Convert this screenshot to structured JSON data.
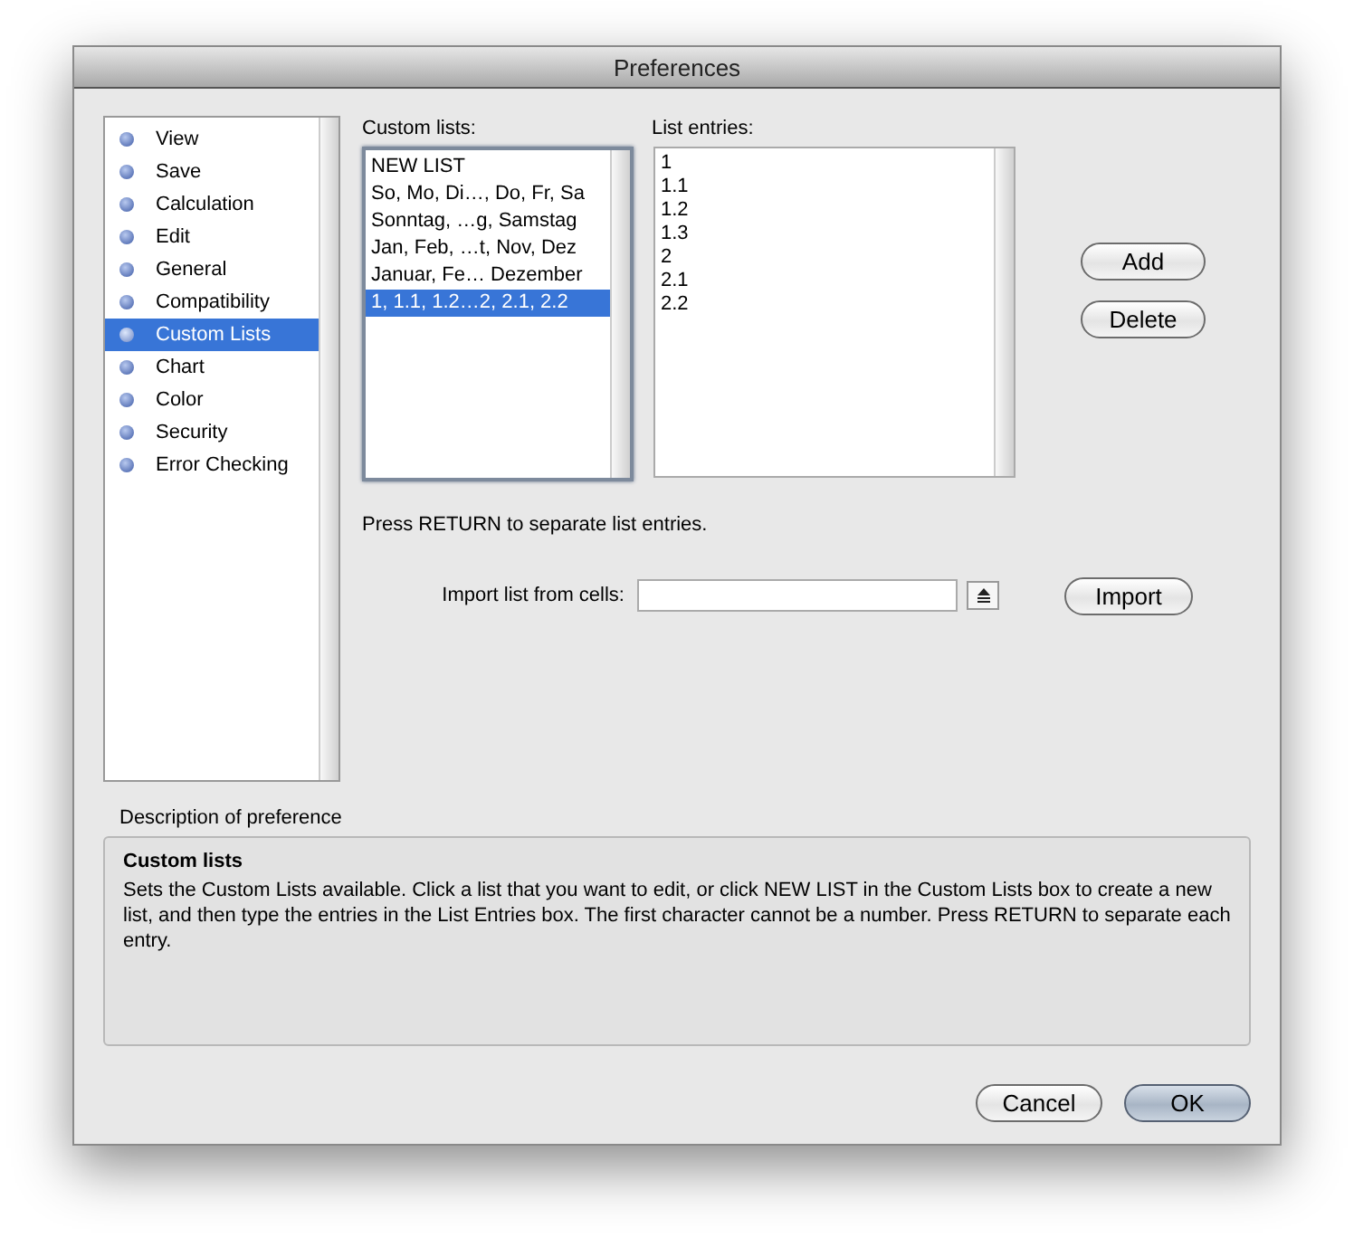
{
  "window": {
    "title": "Preferences"
  },
  "sidebar": {
    "items": [
      {
        "label": "View",
        "selected": false
      },
      {
        "label": "Save",
        "selected": false
      },
      {
        "label": "Calculation",
        "selected": false
      },
      {
        "label": "Edit",
        "selected": false
      },
      {
        "label": "General",
        "selected": false
      },
      {
        "label": "Compatibility",
        "selected": false
      },
      {
        "label": "Custom Lists",
        "selected": true
      },
      {
        "label": "Chart",
        "selected": false
      },
      {
        "label": "Color",
        "selected": false
      },
      {
        "label": "Security",
        "selected": false
      },
      {
        "label": "Error Checking",
        "selected": false
      }
    ]
  },
  "custom_lists": {
    "label": "Custom lists:",
    "items": [
      {
        "label": "NEW LIST",
        "selected": false
      },
      {
        "label": "So, Mo, Di…, Do, Fr, Sa",
        "selected": false
      },
      {
        "label": "Sonntag, …g, Samstag",
        "selected": false
      },
      {
        "label": "Jan, Feb, …t, Nov, Dez",
        "selected": false
      },
      {
        "label": "Januar, Fe… Dezember",
        "selected": false
      },
      {
        "label": "1, 1.1, 1.2…2, 2.1, 2.2",
        "selected": true
      }
    ]
  },
  "list_entries": {
    "label": "List entries:",
    "items": [
      "1",
      "1.1",
      "1.2",
      "1.3",
      "2",
      "2.1",
      "2.2"
    ]
  },
  "side_buttons": [
    "Add",
    "Delete"
  ],
  "hint": "Press RETURN to separate list entries.",
  "import": {
    "label": "Import list from cells:",
    "button": "Import"
  },
  "description": {
    "label": "Description of preference",
    "title": "Custom lists",
    "text": "Sets the Custom Lists available. Click a list that you want to edit, or click NEW LIST in the Custom Lists box to create a new list, and then type the entries in the List Entries box. The first character cannot be a number. Press RETURN to separate each entry."
  },
  "buttons": [
    {
      "label": "Cancel",
      "default": false
    },
    {
      "label": "OK",
      "default": true
    }
  ]
}
